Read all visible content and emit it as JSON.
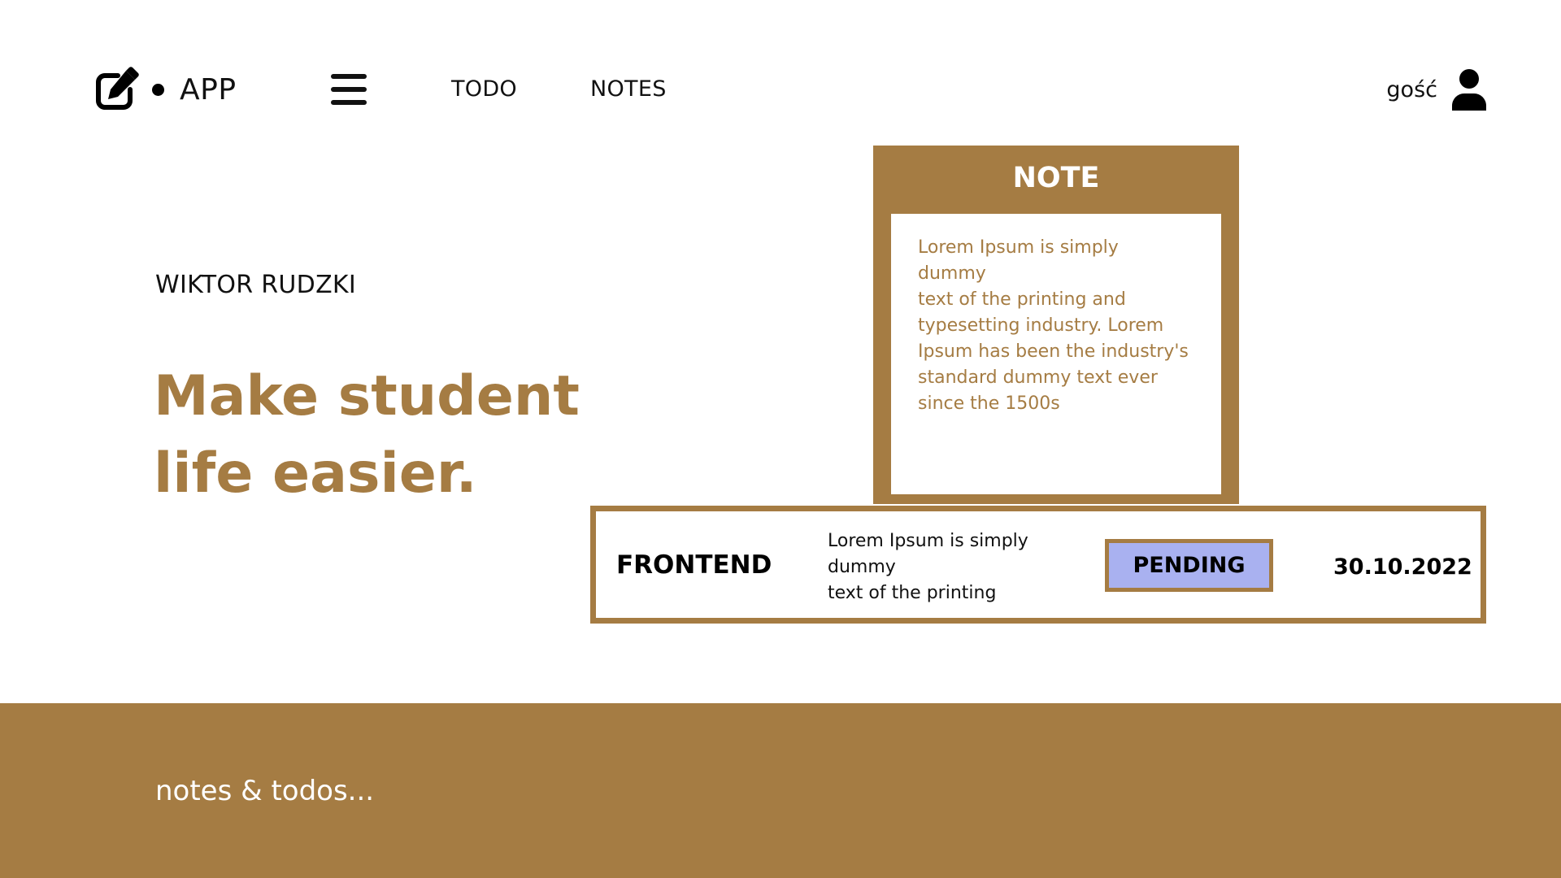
{
  "header": {
    "logo_text": "APP",
    "nav": {
      "todo": "TODO",
      "notes": "NOTES"
    },
    "user_name": "gość",
    "icons": {
      "logo": "edit-square-icon",
      "menu": "hamburger-menu-icon",
      "user": "user-icon"
    }
  },
  "hero": {
    "author": "WIKTOR RUDZKI",
    "headline": "Make student life easier."
  },
  "note_card": {
    "title": "NOTE",
    "text": "Lorem Ipsum is simply\ndummy\ntext of the printing and\ntypesetting industry. Lorem\nIpsum has been the industry's\nstandard dummy text ever\nsince the 1500s"
  },
  "todo": {
    "category": "FRONTEND",
    "description": "Lorem Ipsum is simply\ndummy\ntext of the printing",
    "status": "PENDING",
    "date": "30.10.2022"
  },
  "footer": {
    "text": "notes & todos..."
  },
  "colors": {
    "accent": "#a57c43",
    "status_pending": "#a9b1f0",
    "background": "#ffffff",
    "text": "#111111"
  }
}
